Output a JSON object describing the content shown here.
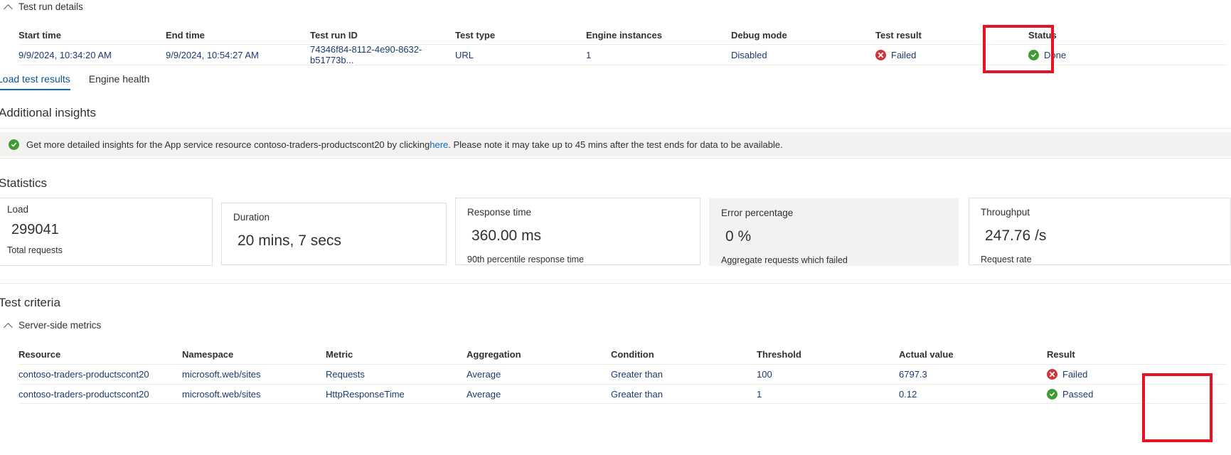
{
  "test_run_details": {
    "section_title": "Test run details",
    "columns": [
      "Start time",
      "End time",
      "Test run ID",
      "Test type",
      "Engine instances",
      "Debug mode",
      "Test result",
      "Status"
    ],
    "rows": [
      {
        "start_time": "9/9/2024, 10:34:20 AM",
        "end_time": "9/9/2024, 10:54:27 AM",
        "test_run_id": "74346f84-8112-4e90-8632-b51773b...",
        "test_type": "URL",
        "engine_instances": "1",
        "debug_mode": "Disabled",
        "test_result": "Failed",
        "test_result_icon": "error-circle-icon",
        "status": "Done",
        "status_icon": "success-circle-icon"
      }
    ]
  },
  "tabs": [
    {
      "label": "Load test results",
      "active": true
    },
    {
      "label": "Engine health",
      "active": false
    }
  ],
  "additional_insights": {
    "title": "Additional insights",
    "icon": "success-circle-icon",
    "text_before_link": "Get more detailed insights for the App service resource contoso-traders-productscont20 by clicking ",
    "link_text": "here",
    "text_after_link": ". Please note it may take up to 45 mins after the test ends for data to be available."
  },
  "statistics": {
    "title": "Statistics",
    "cards": [
      {
        "label": "Load",
        "value": "299041",
        "sub": "Total requests",
        "hovered": false
      },
      {
        "label": "Duration",
        "value": "20 mins, 7 secs",
        "sub": "",
        "hovered": false
      },
      {
        "label": "Response time",
        "value": "360.00 ms",
        "sub": "90th percentile response time",
        "hovered": false
      },
      {
        "label": "Error percentage",
        "value": "0 %",
        "sub": "Aggregate requests which failed",
        "hovered": true
      },
      {
        "label": "Throughput",
        "value": "247.76 /s",
        "sub": "Request rate",
        "hovered": false
      }
    ]
  },
  "test_criteria": {
    "title": "Test criteria",
    "group_label": "Server-side metrics",
    "columns": [
      "Resource",
      "Namespace",
      "Metric",
      "Aggregation",
      "Condition",
      "Threshold",
      "Actual value",
      "Result"
    ],
    "rows": [
      {
        "resource": "contoso-traders-productscont20",
        "namespace": "microsoft.web/sites",
        "metric": "Requests",
        "aggregation": "Average",
        "condition": "Greater than",
        "threshold": "100",
        "actual_value": "6797.3",
        "result": "Failed",
        "result_icon": "error-circle-icon"
      },
      {
        "resource": "contoso-traders-productscont20",
        "namespace": "microsoft.web/sites",
        "metric": "HttpResponseTime",
        "aggregation": "Average",
        "condition": "Greater than",
        "threshold": "1",
        "actual_value": "0.12",
        "result": "Passed",
        "result_icon": "success-circle-icon"
      }
    ]
  },
  "annotations": {
    "highlight_test_result_column": "Test result",
    "highlight_result_column": "Result"
  },
  "colors": {
    "accent": "#0f6cbd",
    "fail": "#d13438",
    "pass": "#3f9c35",
    "annotation": "#e81123",
    "link": "#0f6cbd",
    "value_text": "#1b3b6f"
  }
}
